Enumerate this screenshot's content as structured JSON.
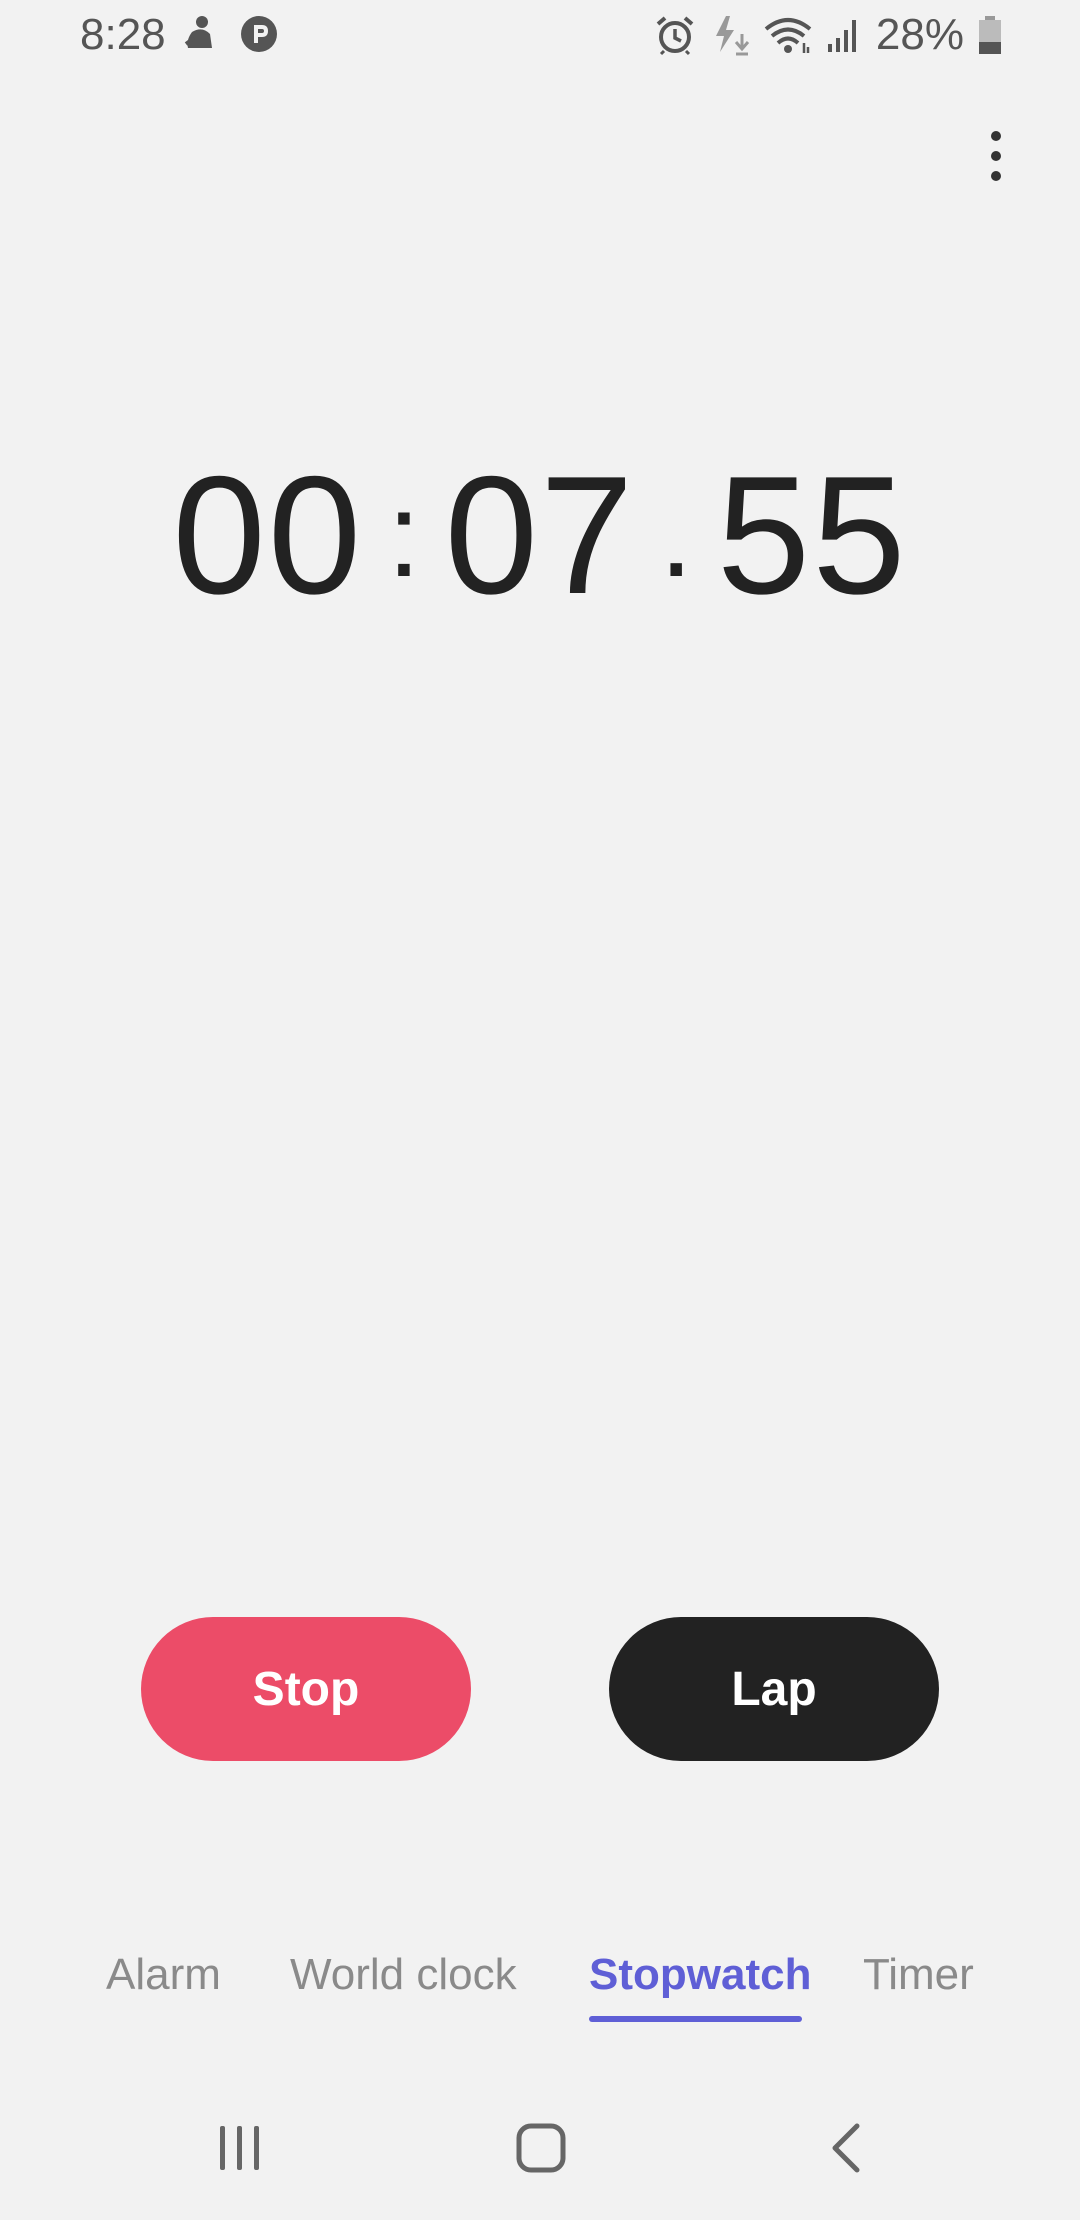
{
  "status_bar": {
    "time": "8:28",
    "battery": "28%",
    "left_icons": [
      "notification-icon",
      "p-app-icon"
    ],
    "right_icons": [
      "alarm-icon",
      "charging-icon",
      "wifi-icon",
      "signal-icon",
      "battery-icon"
    ]
  },
  "menu": {
    "more_icon": "more-vertical-icon"
  },
  "stopwatch": {
    "minutes": "00",
    "seconds": "07",
    "hundredths": "55",
    "sep1": ":",
    "sep2": "."
  },
  "buttons": {
    "stop_label": "Stop",
    "lap_label": "Lap"
  },
  "tabs": [
    {
      "label": "Alarm",
      "active": false
    },
    {
      "label": "World clock",
      "active": false
    },
    {
      "label": "Stopwatch",
      "active": true
    },
    {
      "label": "Timer",
      "active": false
    }
  ],
  "nav_bar": {
    "recents_icon": "recents-icon",
    "home_icon": "home-icon",
    "back_icon": "back-icon"
  },
  "colors": {
    "background": "#f2f2f2",
    "stop_button": "#ec4c68",
    "lap_button": "#222222",
    "active_tab": "#5f5fd6",
    "inactive_tab": "#8a8a8a",
    "time_text": "#222222"
  }
}
